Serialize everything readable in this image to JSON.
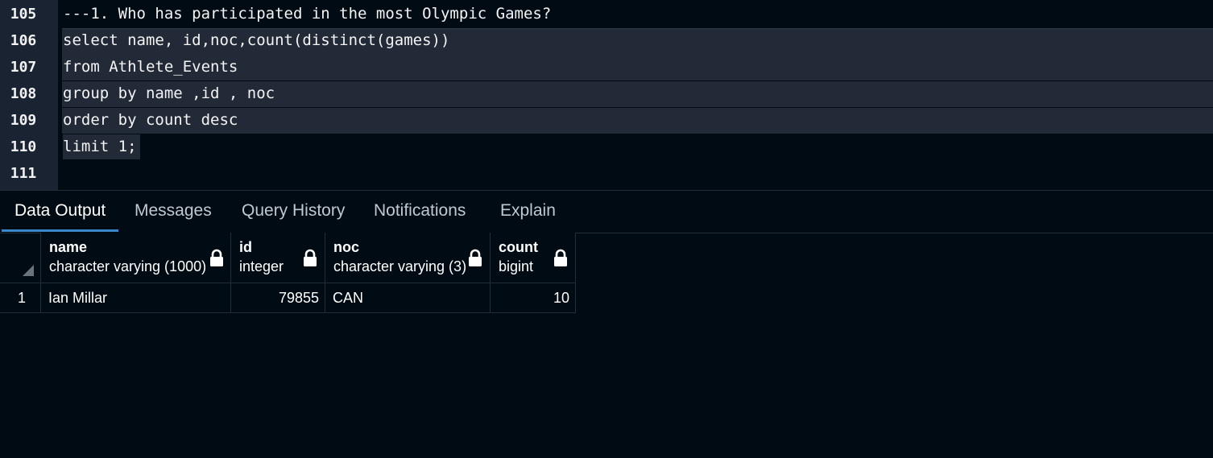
{
  "editor": {
    "lines": [
      {
        "num": "105",
        "code": "---1. Who has participated in the most Olympic Games?"
      },
      {
        "num": "106",
        "code": "select name, id,noc,count(distinct(games))"
      },
      {
        "num": "107",
        "code": "from Athlete_Events"
      },
      {
        "num": "108",
        "code": "group by name ,id , noc"
      },
      {
        "num": "109",
        "code": "order by count desc"
      },
      {
        "num": "110",
        "code": "limit 1;"
      },
      {
        "num": "111",
        "code": ""
      }
    ]
  },
  "tabs": [
    {
      "label": "Data Output"
    },
    {
      "label": "Messages"
    },
    {
      "label": "Query History"
    },
    {
      "label": "Notifications"
    },
    {
      "label": "Explain"
    }
  ],
  "grid": {
    "columns": [
      {
        "name": "name",
        "type": "character varying (1000)"
      },
      {
        "name": "id",
        "type": "integer"
      },
      {
        "name": "noc",
        "type": "character varying (3)"
      },
      {
        "name": "count",
        "type": "bigint"
      }
    ],
    "rows": [
      {
        "rownum": "1",
        "cells": [
          "Ian Millar",
          "79855",
          "CAN",
          "10"
        ]
      }
    ]
  },
  "colors": {
    "background": "#010b14",
    "gutter": "#1a2332",
    "selection": "#212a36",
    "active_tab_underline": "#3a88c9"
  }
}
